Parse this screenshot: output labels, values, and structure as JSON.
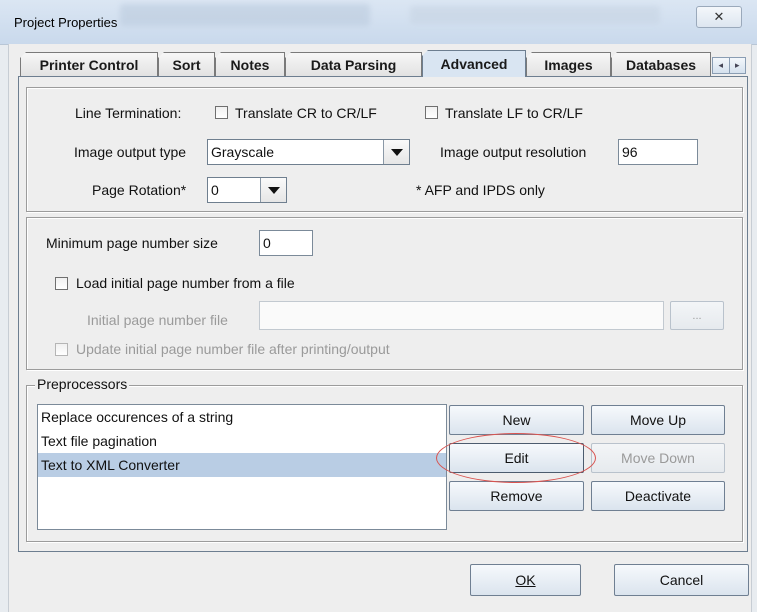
{
  "window": {
    "title": "Project Properties",
    "close_glyph": "✕"
  },
  "tabs": [
    {
      "label": "Printer Control"
    },
    {
      "label": "Sort"
    },
    {
      "label": "Notes"
    },
    {
      "label": "Data Parsing"
    },
    {
      "label": "Advanced",
      "active": true
    },
    {
      "label": "Images"
    },
    {
      "label": "Databases"
    }
  ],
  "tab_scroll": {
    "left": "◂",
    "right": "▸"
  },
  "top_group": {
    "line_termination_label": "Line Termination:",
    "cr_to_crlf_label": "Translate CR to CR/LF",
    "cr_to_crlf_checked": false,
    "lf_to_crlf_label": "Translate LF to CR/LF",
    "lf_to_crlf_checked": false,
    "image_type_label": "Image output type",
    "image_type_value": "Grayscale",
    "image_res_label": "Image output resolution",
    "image_res_value": "96",
    "page_rotation_label": "Page Rotation*",
    "page_rotation_value": "0",
    "afp_note": "* AFP and IPDS only"
  },
  "page_group": {
    "min_page_label": "Minimum page number size",
    "min_page_value": "0",
    "load_initial_label": "Load initial page number from a file",
    "load_initial_checked": false,
    "initial_file_label": "Initial page number file",
    "initial_file_value": "",
    "browse_label": "...",
    "update_file_label": "Update initial page number file after printing/output",
    "update_file_checked": false
  },
  "preprocessors": {
    "legend": "Preprocessors",
    "items": [
      {
        "label": "Replace occurences of a string"
      },
      {
        "label": "Text file pagination"
      },
      {
        "label": "Text to XML Converter",
        "selected": true
      }
    ],
    "buttons": {
      "new": "New",
      "move_up": "Move Up",
      "edit": "Edit",
      "move_down": "Move Down",
      "remove": "Remove",
      "deactivate": "Deactivate"
    }
  },
  "footer": {
    "ok_label": "OK",
    "cancel_label": "Cancel"
  },
  "colors": {
    "selection": "#b9cde4",
    "highlight_ring": "#d9534f",
    "active_tab": "#d9e5f2"
  }
}
